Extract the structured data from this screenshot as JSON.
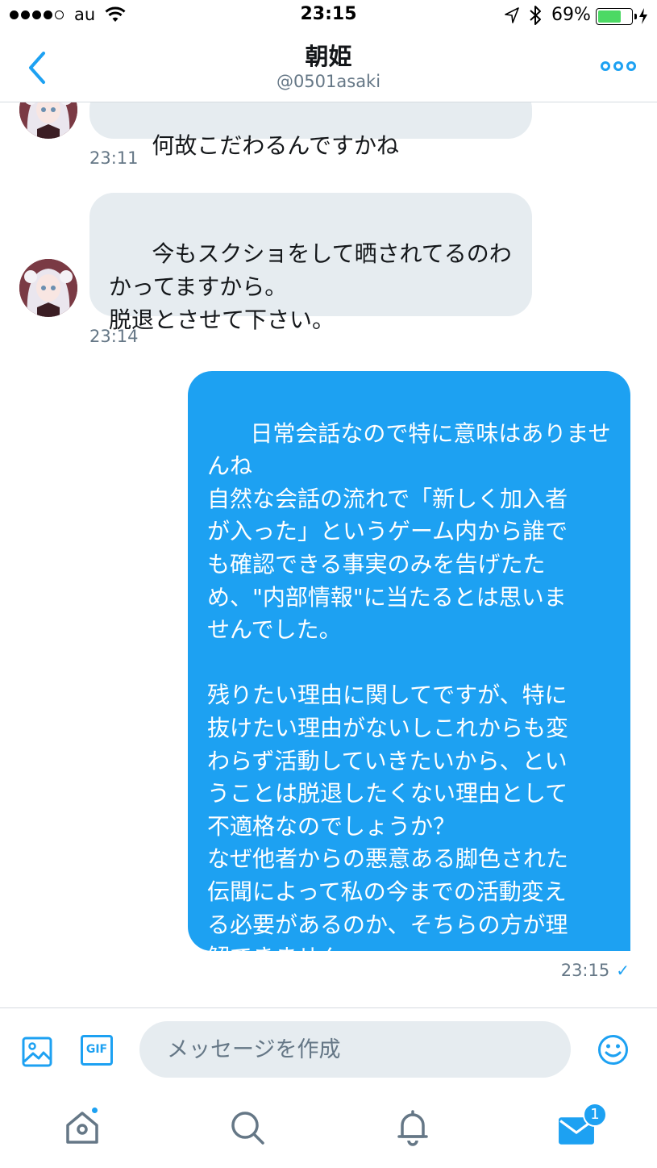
{
  "status_bar": {
    "carrier": "au",
    "time": "23:15",
    "battery_percent": "69%",
    "battery_level": 0.69,
    "signal_bars_filled": 4,
    "signal_bars_total": 5
  },
  "header": {
    "title": "朝姫",
    "handle": "@0501asaki"
  },
  "messages": [
    {
      "direction": "incoming",
      "text": "何故こだわるんですかね",
      "time": "23:11"
    },
    {
      "direction": "incoming",
      "text": "今もスクショをして晒されてるのわ\nかってますから。\n脱退とさせて下さい。",
      "time": "23:14"
    },
    {
      "direction": "outgoing",
      "text": "日常会話なので特に意味はありませ\nんね\n自然な会話の流れで「新しく加入者\nが入った」というゲーム内から誰で\nも確認できる事実のみを告げたた\nめ、\"内部情報\"に当たるとは思いま\nせんでした。\n\n残りたい理由に関してですが、特に\n抜けたい理由がないしこれからも変\nわらず活動していきたいから、とい\nうことは脱退したくない理由として\n不適格なのでしょうか？\nなぜ他者からの悪意ある脚色された\n伝聞によって私の今までの活動変え\nる必要があるのか、そちらの方が理\n解できません。",
      "time": "23:15",
      "read_mark": "✓"
    }
  ],
  "composer": {
    "placeholder": "メッセージを作成",
    "gif_label": "GIF"
  },
  "tab_bar": {
    "messages_badge": "1"
  },
  "colors": {
    "accent": "#1da1f2",
    "incoming_bubble": "#e6ecf0",
    "secondary_text": "#657786",
    "battery_fill": "#4cd964"
  }
}
